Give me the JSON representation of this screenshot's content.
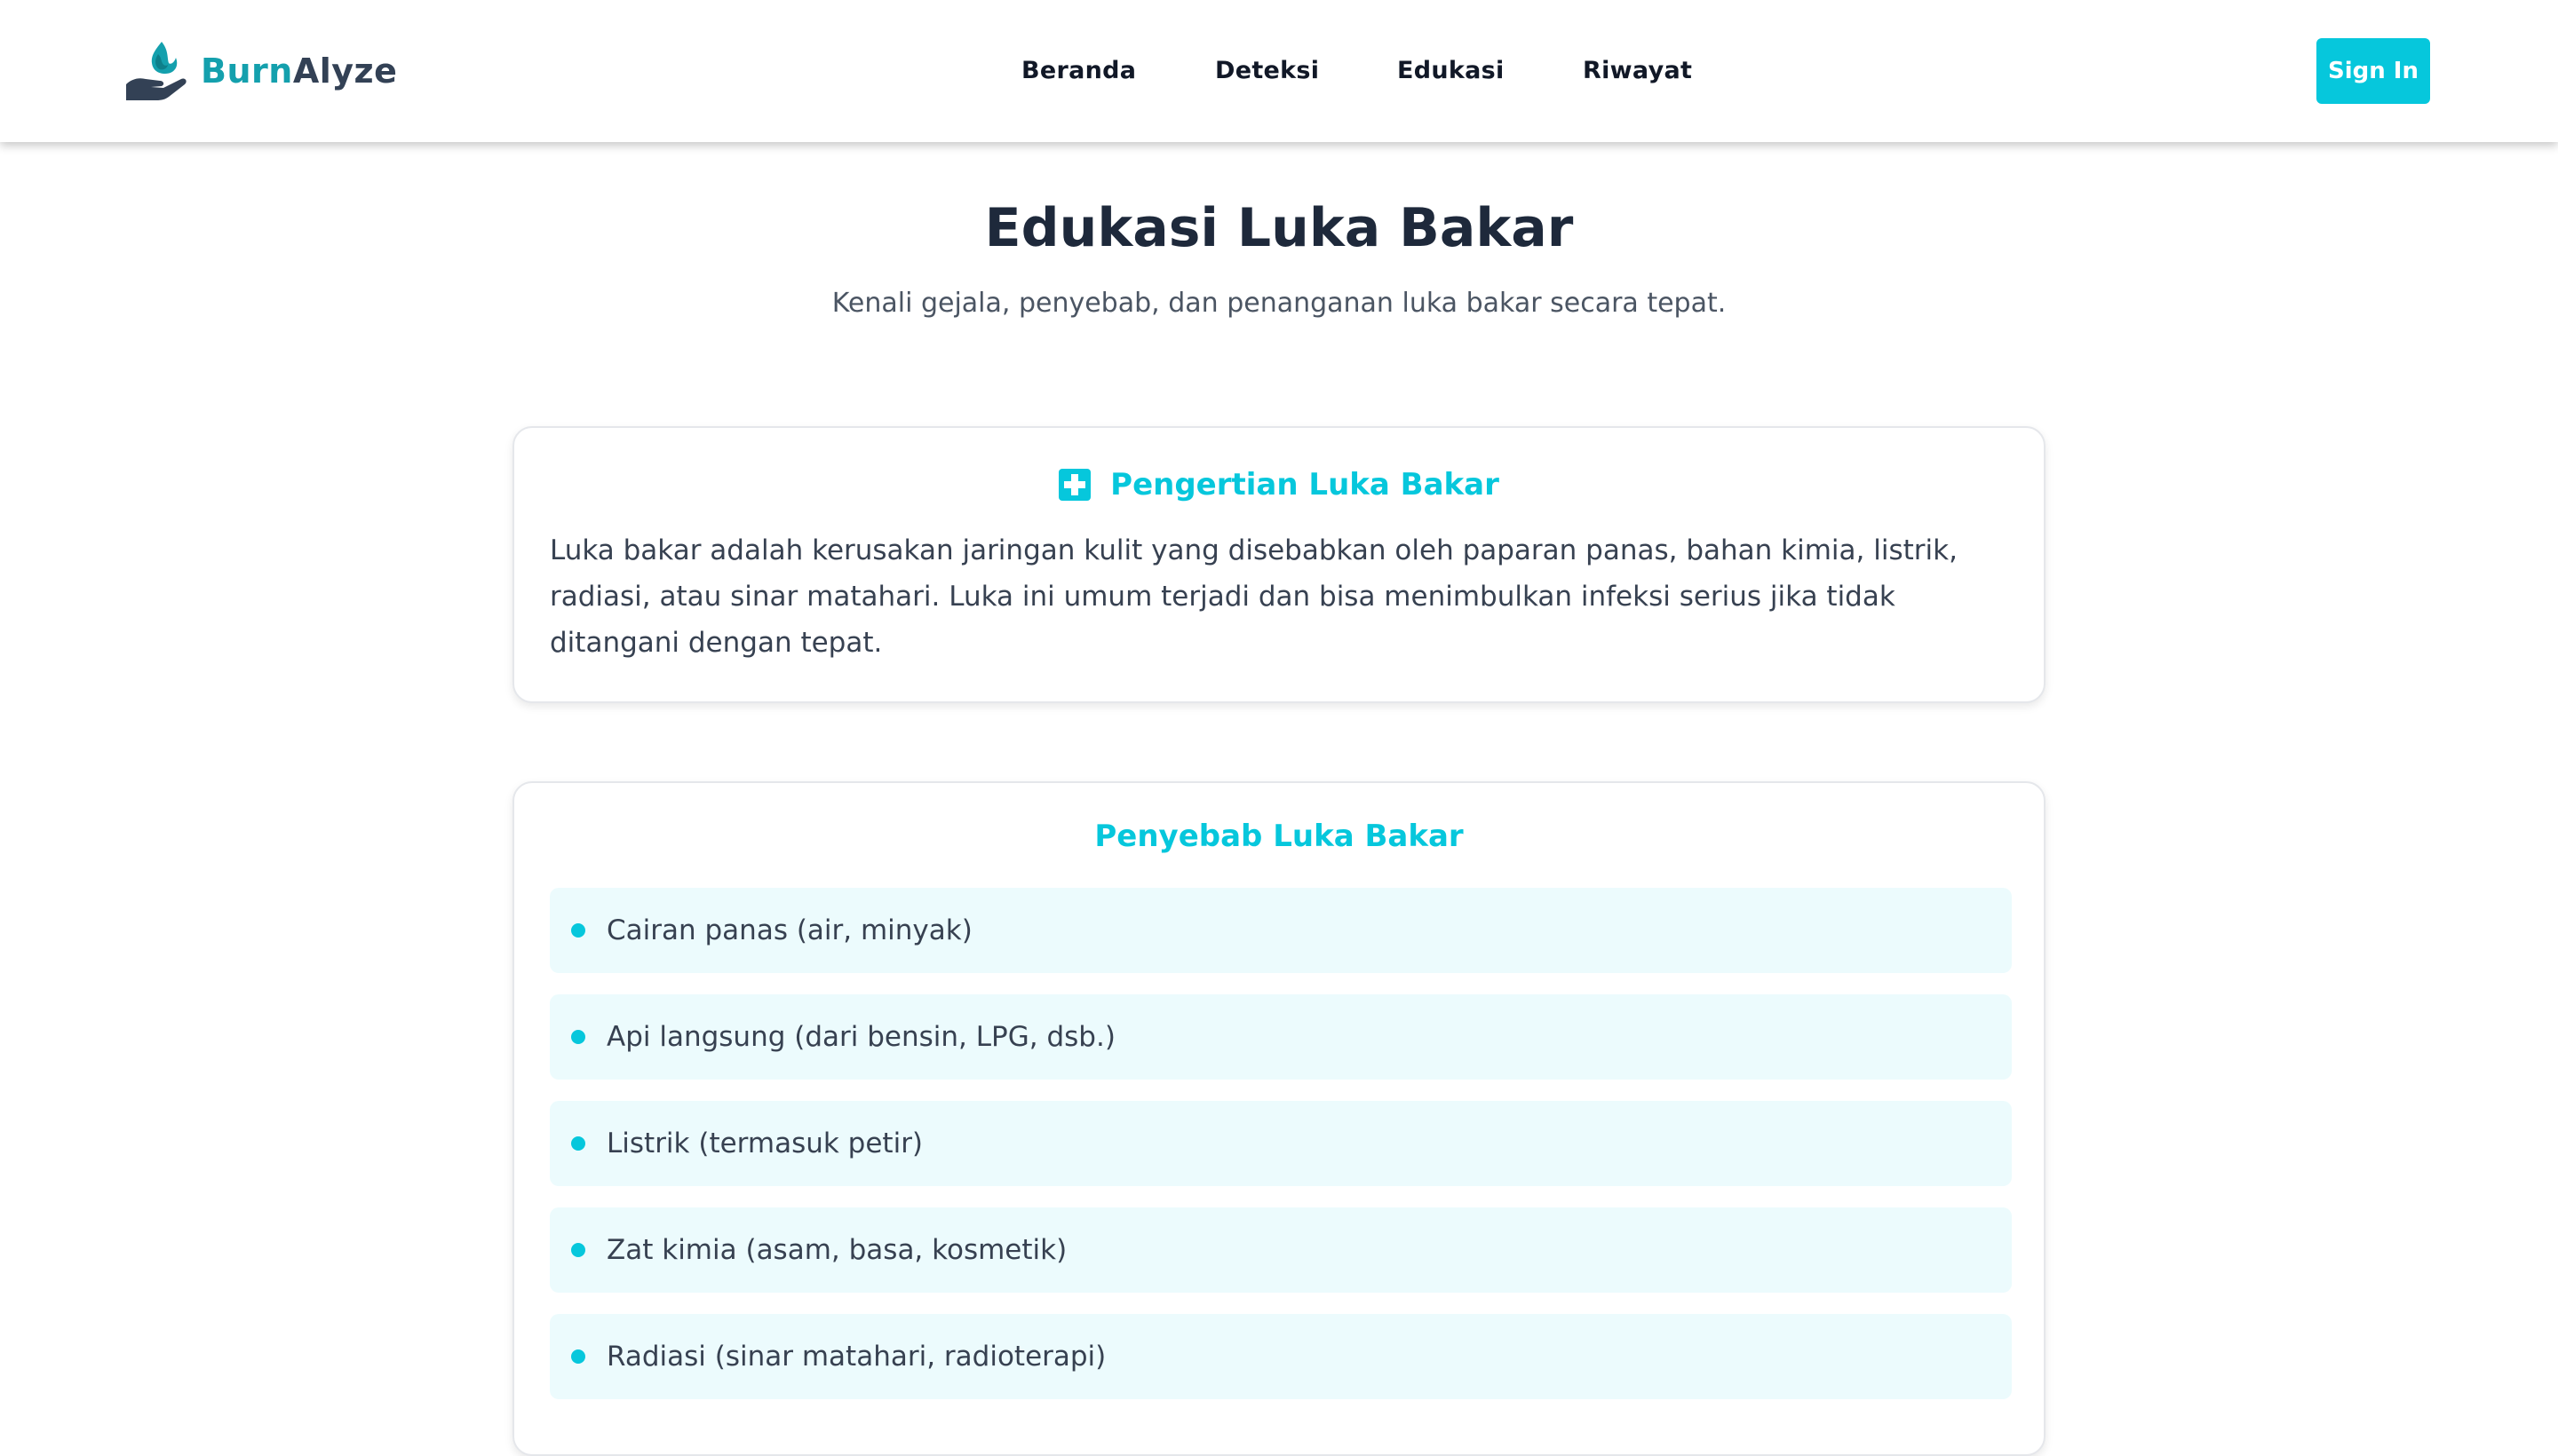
{
  "brand": {
    "name_part1": "Burn",
    "name_part2": "Alyze",
    "icon": "flame-hand-icon"
  },
  "nav": {
    "links": [
      {
        "label": "Beranda"
      },
      {
        "label": "Deteksi"
      },
      {
        "label": "Edukasi"
      },
      {
        "label": "Riwayat"
      }
    ],
    "sign_in_label": "Sign In"
  },
  "page": {
    "title": "Edukasi Luka Bakar",
    "subtitle": "Kenali gejala, penyebab, dan penanganan luka bakar secara tepat."
  },
  "definition": {
    "icon": "plus-square-icon",
    "heading": "Pengertian Luka Bakar",
    "body": "Luka bakar adalah kerusakan jaringan kulit yang disebabkan oleh paparan panas, bahan kimia, listrik, radiasi, atau sinar matahari. Luka ini umum terjadi dan bisa menimbulkan infeksi serius jika tidak ditangani dengan tepat."
  },
  "causes": {
    "heading": "Penyebab Luka Bakar",
    "items": [
      {
        "label": "Cairan panas (air, minyak)"
      },
      {
        "label": "Api langsung (dari bensin, LPG, dsb.)"
      },
      {
        "label": "Listrik (termasuk petir)"
      },
      {
        "label": "Zat kimia (asam, basa, kosmetik)"
      },
      {
        "label": "Radiasi (sinar matahari, radioterapi)"
      }
    ]
  },
  "colors": {
    "accent": "#06c7dc",
    "brand_teal": "#14a0ad",
    "brand_dark": "#334155",
    "list_bg": "#ecfbfd"
  }
}
